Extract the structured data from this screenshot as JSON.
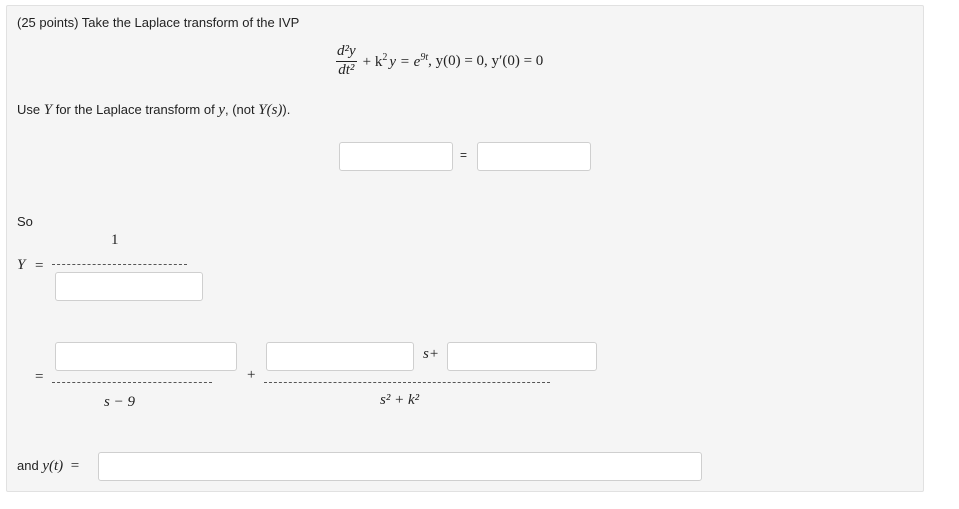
{
  "question": {
    "intro": "(25 points) Take the Laplace transform of the IVP",
    "equation": {
      "numerator": "d²y",
      "denominator": "dt²",
      "rest_a": "+ k",
      "rest_a_sup": "2",
      "rest_b": "y = e",
      "rest_b_sup": "9t",
      "rest_c": ", y(0) = 0, y′(0) = 0"
    },
    "instruction_prefix": "Use",
    "instruction_Y": "Y",
    "instruction_mid": "for the Laplace transform of",
    "instruction_y": "y",
    "instruction_not": ", (not",
    "instruction_Ys": "Y(s)",
    "instruction_end": ")."
  },
  "transform_row": {
    "equals_label": "=",
    "left_value": "",
    "right_value": ""
  },
  "so_section": {
    "so_label": "So",
    "Y_label": "Y",
    "equals": "=",
    "numerator_one": "1",
    "denominator_value": ""
  },
  "partial_fractions": {
    "equals": "=",
    "first_numerator_value": "",
    "first_denominator": "s − 9",
    "plus": "+",
    "second_numerator_value_a": "",
    "s_plus_label": "s+",
    "second_numerator_value_b": "",
    "second_denominator": "s² + k²"
  },
  "answer": {
    "prefix": "and",
    "y_of_t": "y(t)",
    "equals": "=",
    "value": ""
  },
  "colors": {
    "panel_bg": "#f5f5f5",
    "panel_border": "#e1e1e1",
    "input_border": "#cfcfcf"
  }
}
